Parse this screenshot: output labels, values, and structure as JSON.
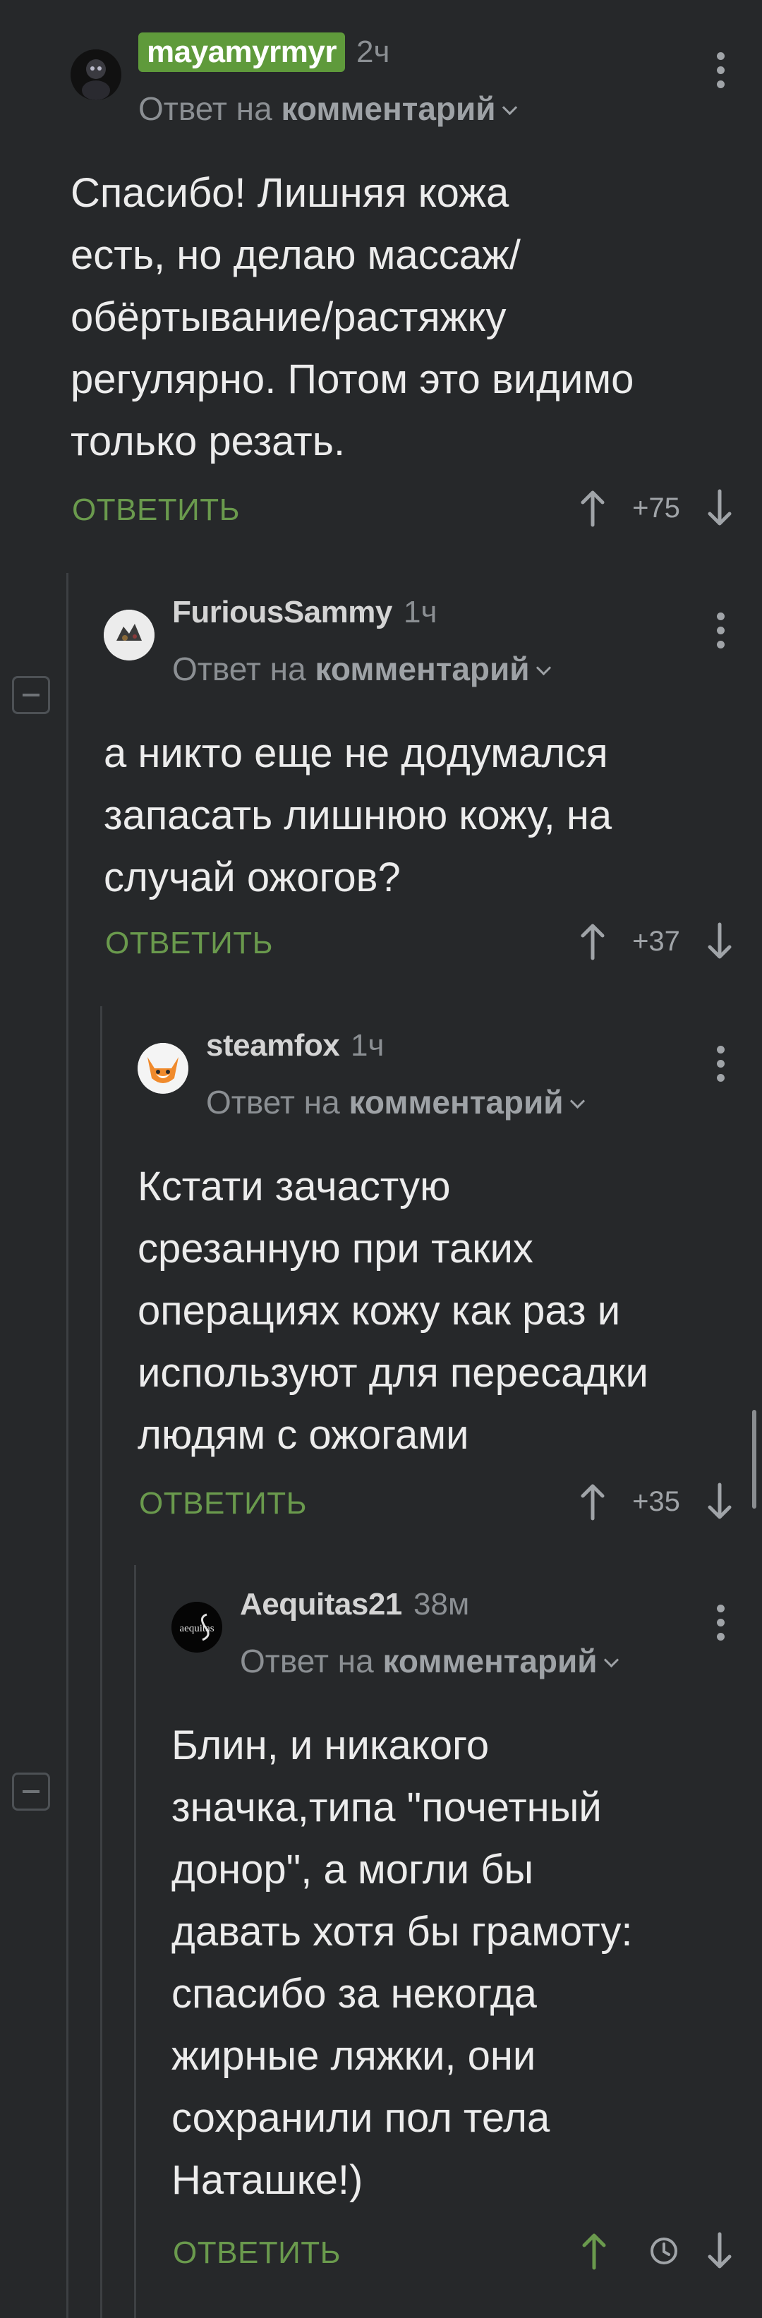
{
  "comments": [
    {
      "author": "mayamyrmyr",
      "is_op": true,
      "time": "2ч",
      "reply_prefix": "Ответ на",
      "reply_target": "комментарий",
      "text": "Спасибо! Лишняя кожа\nесть, но делаю массаж/\nобёртывание/растяжку\nрегулярно. Потом это видимо\nтолько резать.",
      "reply_label": "ОТВЕТИТЬ",
      "rating": "+75"
    },
    {
      "author": "FuriousSammy",
      "is_op": false,
      "time": "1ч",
      "reply_prefix": "Ответ на",
      "reply_target": "комментарий",
      "text": "а никто еще не додумался\nзапасать лишнюю кожу, на\nслучай ожогов?",
      "reply_label": "ОТВЕТИТЬ",
      "rating": "+37"
    },
    {
      "author": "steamfox",
      "is_op": false,
      "time": "1ч",
      "reply_prefix": "Ответ на",
      "reply_target": "комментарий",
      "text": "Кстати зачастую\nсрезанную при таких\nоперациях кожу как раз и\nиспользуют для пересадки\nлюдям с ожогами",
      "reply_label": "ОТВЕТИТЬ",
      "rating": "+35"
    },
    {
      "author": "Aequitas21",
      "is_op": false,
      "time": "38м",
      "reply_prefix": "Ответ на",
      "reply_target": "комментарий",
      "text": "Блин, и никакого\nзначка,типа \"почетный\nдонор\", а могли бы\nдавать хотя бы грамоту:\nспасибо за некогда\nжирные ляжки, они\nсохранили пол тела\nНаташке!)",
      "reply_label": "ОТВЕТИТЬ",
      "rating_hidden": true
    }
  ],
  "colors": {
    "background": "#26282a",
    "accent_green": "#6a9a4d",
    "op_badge": "#5f9a3b",
    "muted_text": "#8b8f93"
  },
  "icons": [
    "more-vert-icon",
    "arrow-up-icon",
    "arrow-down-icon",
    "clock-icon",
    "collapse-icon"
  ]
}
